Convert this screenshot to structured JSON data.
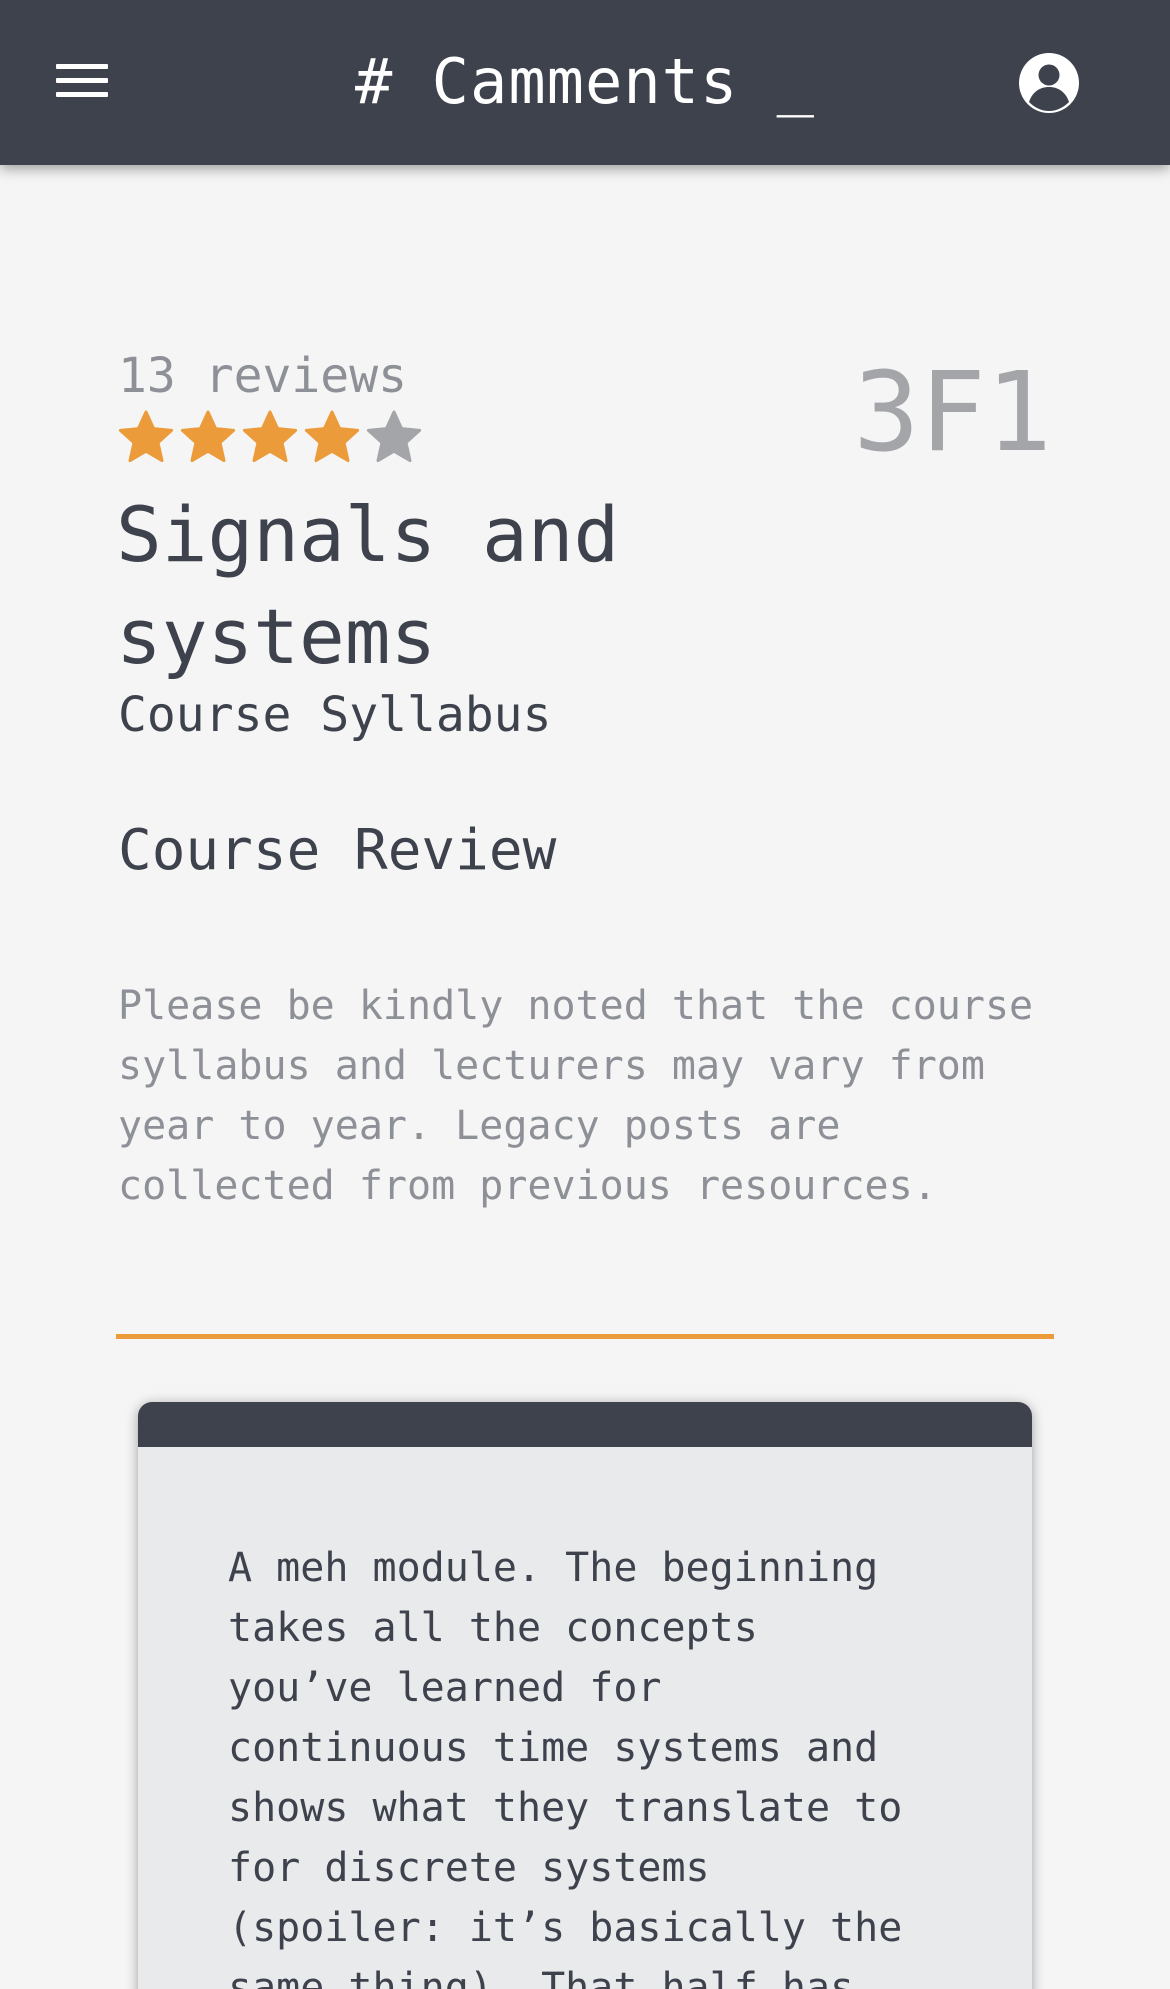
{
  "header": {
    "brand": "# Camments _",
    "menu_icon": "hamburger-menu-icon",
    "account_icon": "user-circle-icon"
  },
  "course": {
    "reviews_count": "13 reviews",
    "rating": 4,
    "rating_max": 5,
    "code": "3F1",
    "title": "Signals and systems",
    "syllabus_link": "Course Syllabus"
  },
  "review_section": {
    "heading": "Course Review",
    "notice": "Please be kindly noted that the course syllabus and lecturers may vary from year to year. Legacy posts are collected from previous resources."
  },
  "reviews": [
    {
      "text": "A meh module. The beginning\ntakes all the concepts\nyou’ve learned for\ncontinuous time systems and\nshows what they translate to\nfor discrete systems\n(spoiler: it’s basically the\nsame thing). That half has"
    }
  ],
  "colors": {
    "topbar": "#3d424d",
    "star_filled": "#ec9b3b",
    "star_empty": "#a3a5a9",
    "accent_divider": "#ec9b3b",
    "background": "#f5f5f5"
  }
}
